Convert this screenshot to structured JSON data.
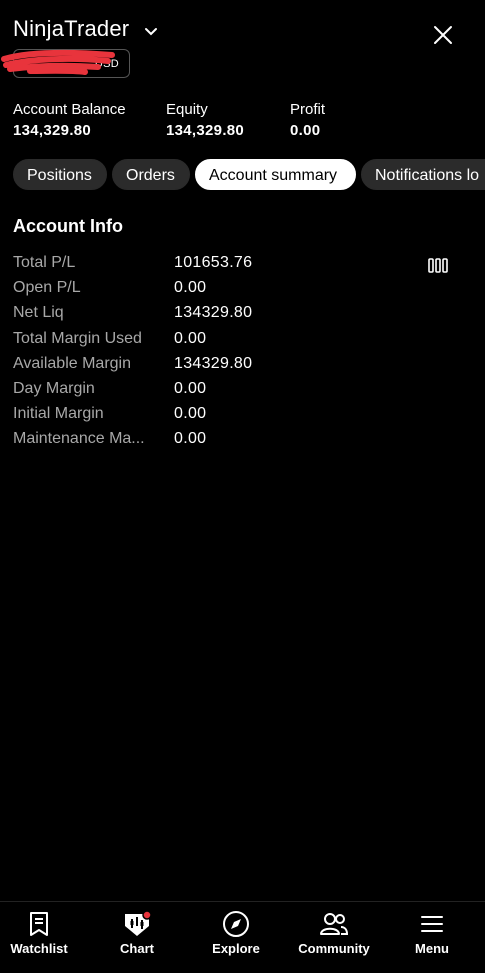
{
  "header": {
    "app_title": "NinjaTrader",
    "account_currency": "USD"
  },
  "stats": {
    "account_balance_label": "Account Balance",
    "account_balance_value": "134,329.80",
    "equity_label": "Equity",
    "equity_value": "134,329.80",
    "profit_label": "Profit",
    "profit_value": "0.00"
  },
  "tabs": [
    {
      "label": "Positions",
      "active": false
    },
    {
      "label": "Orders",
      "active": false
    },
    {
      "label": "Account summary",
      "active": true
    },
    {
      "label": "Notifications lo",
      "active": false
    }
  ],
  "section": {
    "title": "Account Info"
  },
  "account_info": [
    {
      "key": "Total P/L",
      "value": "101653.76"
    },
    {
      "key": "Open P/L",
      "value": "0.00"
    },
    {
      "key": "Net Liq",
      "value": "134329.80"
    },
    {
      "key": "Total Margin Used",
      "value": "0.00"
    },
    {
      "key": "Available Margin",
      "value": "134329.80"
    },
    {
      "key": "Day Margin",
      "value": "0.00"
    },
    {
      "key": "Initial Margin",
      "value": "0.00"
    },
    {
      "key": "Maintenance Ma...",
      "value": "0.00"
    }
  ],
  "bottom_nav": [
    {
      "label": "Watchlist",
      "icon": "watchlist-icon"
    },
    {
      "label": "Chart",
      "icon": "chart-icon"
    },
    {
      "label": "Explore",
      "icon": "compass-icon"
    },
    {
      "label": "Community",
      "icon": "community-icon"
    },
    {
      "label": "Menu",
      "icon": "menu-icon"
    }
  ],
  "colors": {
    "background": "#000000",
    "muted_text": "#a8a8a8",
    "tab_bg": "#2b2b2b",
    "notification_dot": "#e8343c"
  }
}
